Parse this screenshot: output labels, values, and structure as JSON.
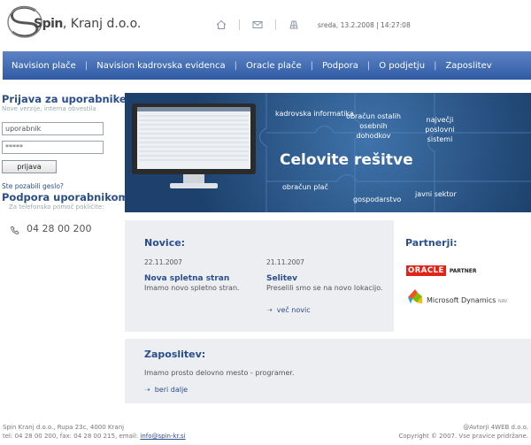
{
  "header": {
    "logo_brand": "Spin",
    "logo_rest": ", Kranj d.o.o.",
    "icons": [
      "home-icon",
      "mail-icon",
      "sitemap-icon"
    ],
    "date": "sreda, 13.2.2008 | 14:27:08"
  },
  "nav": {
    "items": [
      {
        "label": "Navision plače"
      },
      {
        "label": "Navision kadrovska evidenca"
      },
      {
        "label": "Oracle plače"
      },
      {
        "label": "Podpora"
      },
      {
        "label": "O podjetju"
      },
      {
        "label": "Zaposlitev"
      }
    ],
    "background": "#2f5ba4"
  },
  "login": {
    "title": "Prijava za uporabnike:",
    "subtitle": "Nove verzije, interna obvestila",
    "username_value": "uporabnik",
    "password_value": "*****",
    "button_label": "prijava",
    "forgot_label": "Ste pozabili geslo?"
  },
  "support": {
    "title": "Podpora uporabnikom:",
    "subtitle": "Za telefonsko pomoč pokličite:",
    "phone": "04 28 00 200"
  },
  "banner": {
    "words": {
      "kadrovska": "kadrovska informatika",
      "obracun_ostalih": "obračun ostalih osebnih dohodkov",
      "najvecji": "največji poslovni sistemi",
      "obracun_plac": "obračun plač",
      "gospodarstvo": "gospodarstvo",
      "javni": "javni sektor"
    },
    "headline": "Celovite rešitve"
  },
  "novice": {
    "title": "Novice:",
    "items": [
      {
        "date": "22.11.2007",
        "title": "Nova spletna stran",
        "text": "Imamo novo spletno stran."
      },
      {
        "date": "21.11.2007",
        "title": "Selitev",
        "text": "Preselili smo se na novo lokacijo."
      }
    ],
    "more_label": "več novic"
  },
  "partners": {
    "title": "Partnerji:",
    "oracle": {
      "name": "ORACLE",
      "tag": "PARTNER"
    },
    "microsoft": {
      "name": "Microsoft Dynamics",
      "tag": "NAV"
    }
  },
  "zaposlitev": {
    "title": "Zaposlitev:",
    "text": "Imamo prosto delovno mesto - programer.",
    "more_label": "beri dalje"
  },
  "footer": {
    "address": "Spin Kranj d.o.o., Rupa 23c, 4000 Kranj",
    "contact_prefix": "tel: 04 28 00 200, fax: 04 28 00 215, email: ",
    "email": "info@spin-kr.si",
    "authors": "@Avtorji 4WEB d.o.o.",
    "copyright": "Copyright © 2007. Vse pravice pridržane."
  }
}
